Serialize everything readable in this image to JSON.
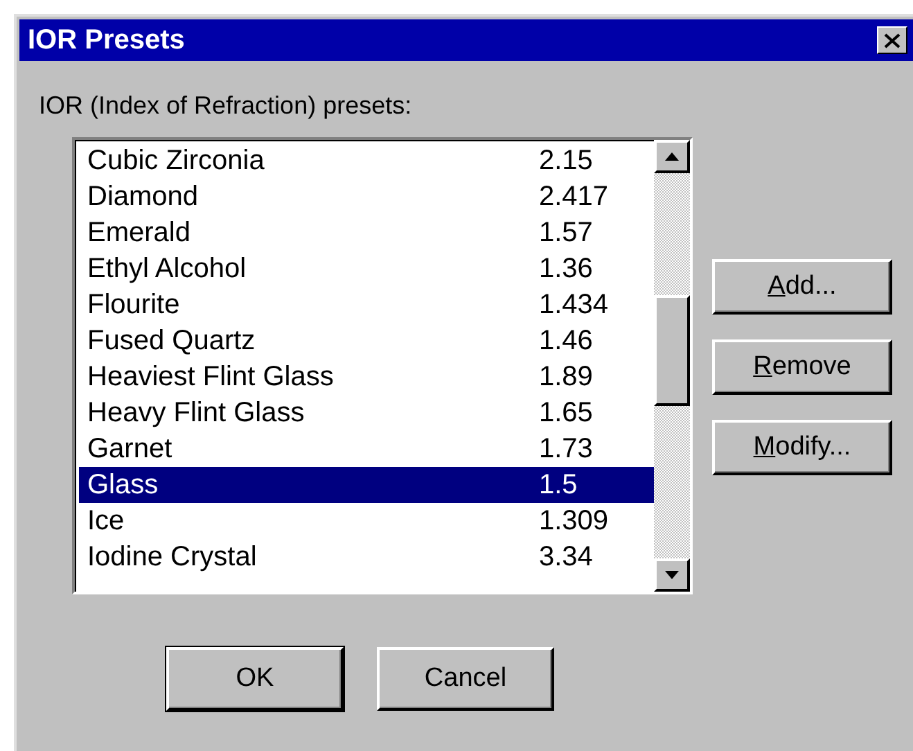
{
  "window": {
    "title": "IOR Presets"
  },
  "label": "IOR (Index of Refraction) presets:",
  "presets": [
    {
      "name": "Cubic Zirconia",
      "value": "2.15",
      "selected": false
    },
    {
      "name": "Diamond",
      "value": "2.417",
      "selected": false
    },
    {
      "name": "Emerald",
      "value": "1.57",
      "selected": false
    },
    {
      "name": "Ethyl Alcohol",
      "value": "1.36",
      "selected": false
    },
    {
      "name": "Flourite",
      "value": "1.434",
      "selected": false
    },
    {
      "name": "Fused Quartz",
      "value": "1.46",
      "selected": false
    },
    {
      "name": "Heaviest Flint Glass",
      "value": "1.89",
      "selected": false
    },
    {
      "name": "Heavy Flint Glass",
      "value": "1.65",
      "selected": false
    },
    {
      "name": "Garnet",
      "value": "1.73",
      "selected": false
    },
    {
      "name": "Glass",
      "value": "1.5",
      "selected": true
    },
    {
      "name": "Ice",
      "value": "1.309",
      "selected": false
    },
    {
      "name": "Iodine Crystal",
      "value": "3.34",
      "selected": false
    }
  ],
  "side_buttons": [
    {
      "mnemonic": "A",
      "rest": "dd..."
    },
    {
      "mnemonic": "R",
      "rest": "emove"
    },
    {
      "mnemonic": "M",
      "rest": "odify..."
    }
  ],
  "buttons": [
    {
      "label": "OK"
    },
    {
      "label": "Cancel"
    }
  ]
}
